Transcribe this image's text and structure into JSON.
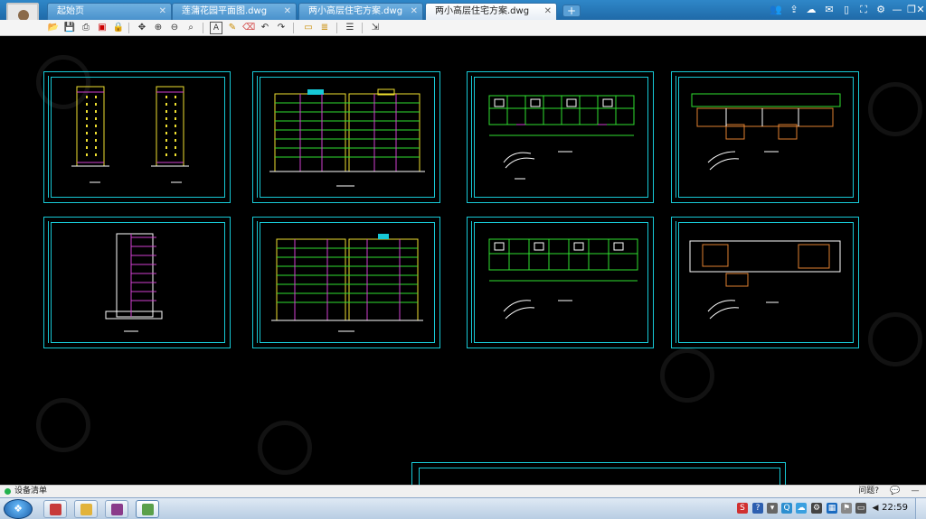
{
  "tabs": [
    {
      "label": "起始页",
      "active": false
    },
    {
      "label": "莲蒲花园平面图.dwg",
      "active": false
    },
    {
      "label": "两小高层住宅方案.dwg",
      "active": false
    },
    {
      "label": "两小高层住宅方案.dwg",
      "active": true
    }
  ],
  "new_tab_label": "+",
  "toolbar_icons": [
    "open-icon",
    "save-icon",
    "print-icon",
    "pdf-icon",
    "lock-icon",
    "pan-icon",
    "zoom-in-icon",
    "zoom-out-icon",
    "zoom-window-icon",
    "text-icon",
    "pencil-icon",
    "eraser-icon",
    "undo-icon",
    "redo-icon",
    "layer-icon",
    "layer-list-icon",
    "measure-icon",
    "export-icon"
  ],
  "status": {
    "device_label": "设备清单",
    "feedback_label": "问题?"
  },
  "clock": "22:59",
  "colors": {
    "sheet_border": "#17c9d6",
    "tab_bar": "#2f87c8",
    "building_yellow": "#f0e030",
    "building_magenta": "#d040d0",
    "floorplan_green": "#30e030",
    "floorplan_orange": "#e08030"
  }
}
